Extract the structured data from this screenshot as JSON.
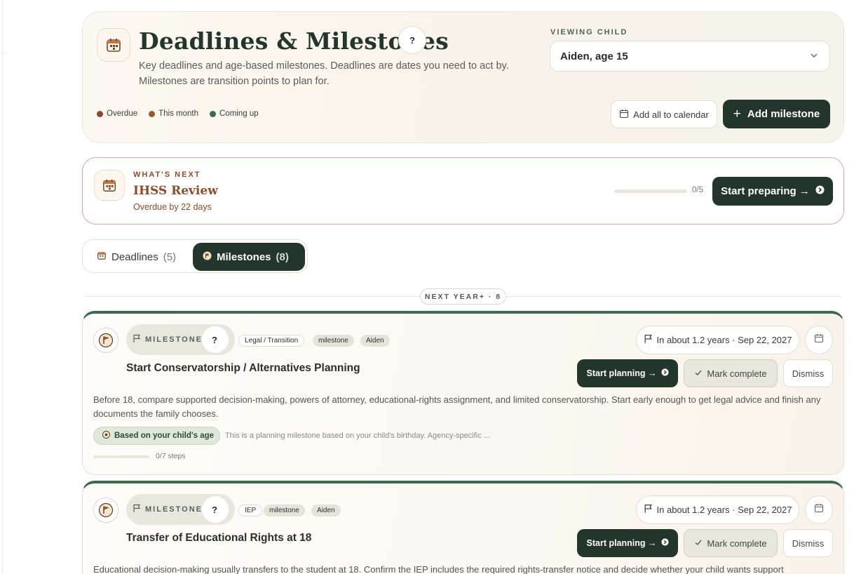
{
  "header": {
    "title": "Deadlines & Milestones",
    "help": "?",
    "subtitle": "Key deadlines and age-based milestones. Deadlines are dates you need to act by. Milestones are transition points to plan for.",
    "viewing_label": "VIEWING CHILD",
    "selected_child": "Aiden, age 15",
    "legend": [
      {
        "label": "Overdue",
        "color": "#8a4b2c"
      },
      {
        "label": "This month",
        "color": "#9a5a2e"
      },
      {
        "label": "Coming up",
        "color": "#3e6b4e"
      }
    ],
    "add_calendar_label": "Add all to calendar",
    "add_milestone_label": "Add milestone"
  },
  "next": {
    "eyebrow": "WHAT'S NEXT",
    "title": "IHSS Review",
    "status": "Overdue by 22 days",
    "progress_text": "0/5",
    "progress": 0,
    "button": "Start preparing →"
  },
  "tabs": [
    {
      "label": "Deadlines",
      "count": "(5)",
      "active": false
    },
    {
      "label": "Milestones",
      "count": "(8)",
      "active": true
    }
  ],
  "group_label": "NEXT YEAR+ · 8",
  "milestones": [
    {
      "type_label": "MILESTONES",
      "help": "?",
      "tags": [
        "Legal / Transition",
        "milestone",
        "Aiden"
      ],
      "title": "Start Conservatorship / Alternatives Planning",
      "date": "In about 1.2 years · Sep 22, 2027",
      "plan_label": "Start planning →",
      "complete_label": "Mark complete",
      "dismiss_label": "Dismiss",
      "description": "Before 18, compare supported decision-making, powers of attorney, educational-rights assignment, and limited conservatorship. Start early enough to get legal advice and finish any documents the family chooses.",
      "age_badge": "Based on your child's age",
      "age_note": "This is a planning milestone based on your child's birthday. Agency-specific ...",
      "steps": "0/7 steps",
      "progress": 0
    },
    {
      "type_label": "MILESTONES",
      "help": "?",
      "tags": [
        "IEP",
        "milestone",
        "Aiden"
      ],
      "title": "Transfer of Educational Rights at 18",
      "date": "In about 1.2 years · Sep 22, 2027",
      "plan_label": "Start planning →",
      "complete_label": "Mark complete",
      "dismiss_label": "Dismiss",
      "description": "Educational decision-making usually transfers to the student at 18. Confirm the IEP includes the required rights-transfer notice and decide whether your child wants support"
    }
  ]
}
